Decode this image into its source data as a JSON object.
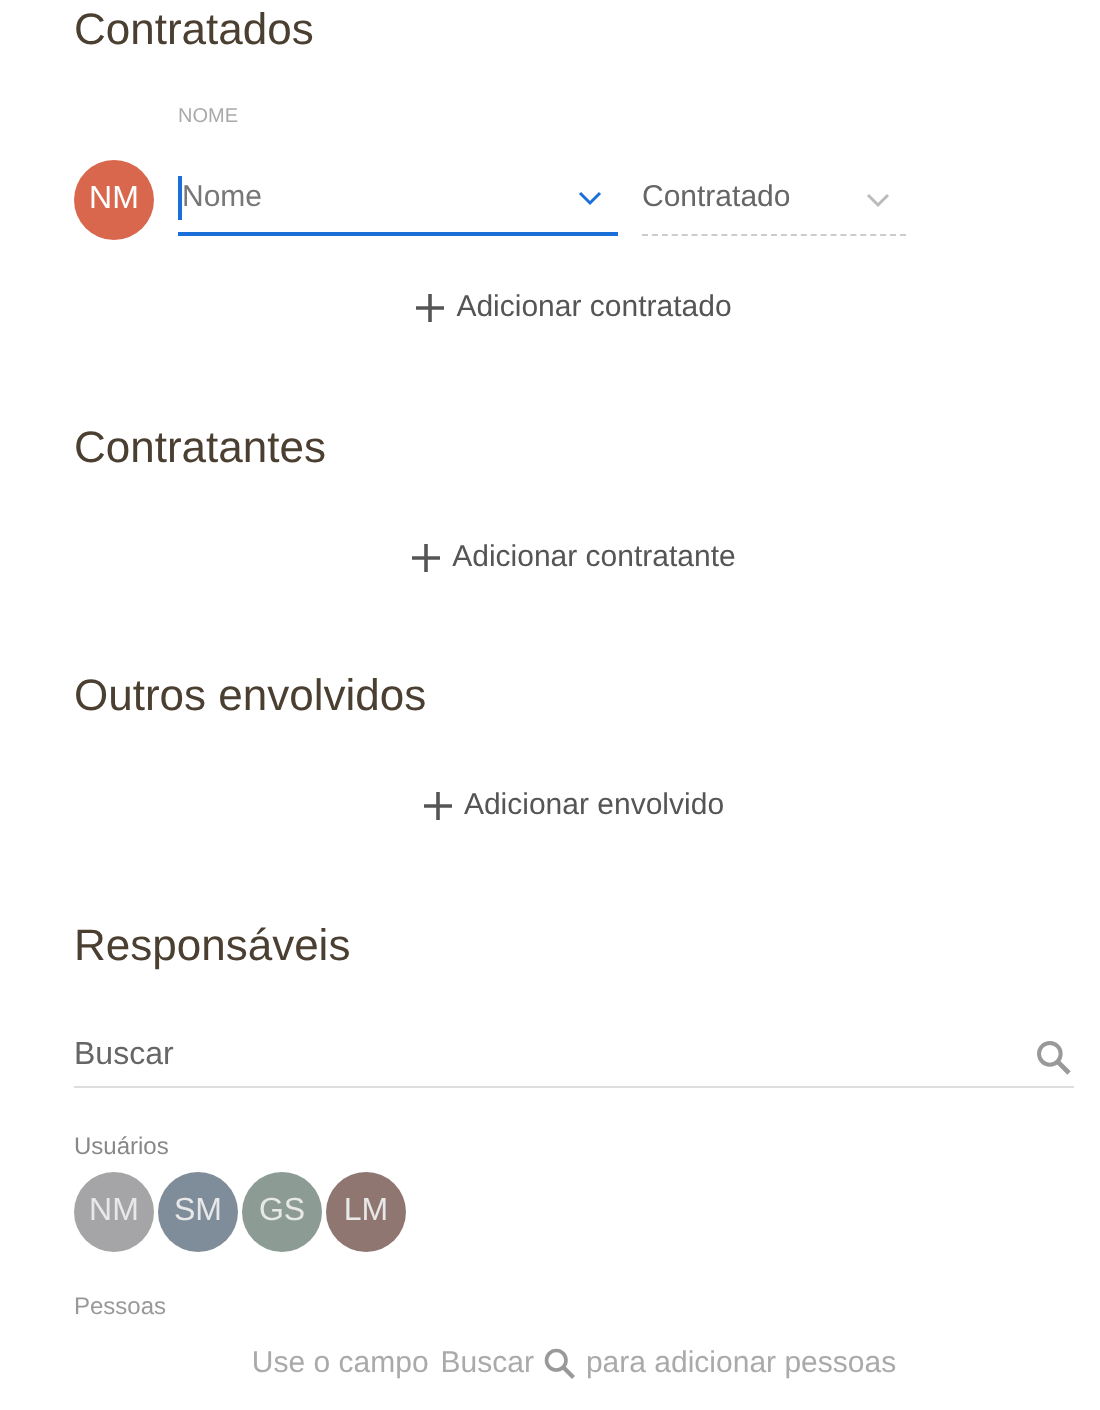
{
  "contratados": {
    "title": "Contratados",
    "column_label": "NOME",
    "rows": [
      {
        "initials": "NM",
        "color": "#d9674e",
        "name_placeholder": "Nome",
        "focused": true,
        "role": "Contratado"
      }
    ],
    "add_label": "Adicionar contratado"
  },
  "contratantes": {
    "title": "Contratantes",
    "add_label": "Adicionar contratante"
  },
  "outros": {
    "title": "Outros envolvidos",
    "add_label": "Adicionar envolvido"
  },
  "responsaveis": {
    "title": "Responsáveis",
    "search": {
      "placeholder": "Buscar"
    },
    "users_label": "Usuários",
    "users": [
      {
        "initials": "NM",
        "color": "#a5a5a8"
      },
      {
        "initials": "SM",
        "color": "#7f8c99"
      },
      {
        "initials": "GS",
        "color": "#8c9c95"
      },
      {
        "initials": "LM",
        "color": "#8f7670"
      }
    ],
    "people_label": "Pessoas",
    "hint_before": "Use o campo",
    "hint_field": "Buscar",
    "hint_after": "para adicionar pessoas"
  }
}
